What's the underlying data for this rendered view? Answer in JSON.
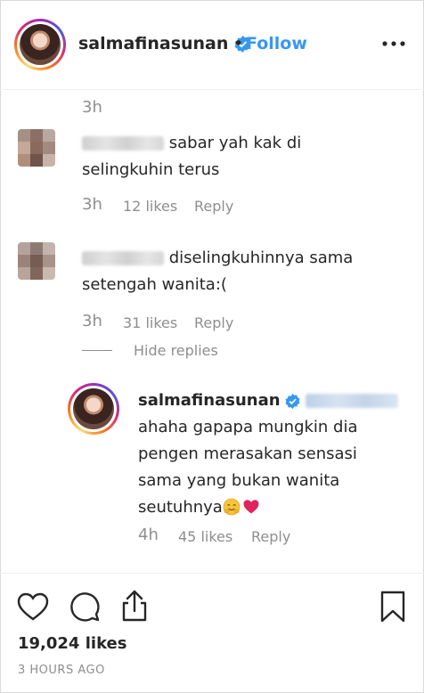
{
  "header": {
    "username": "salmafinasunan",
    "separator": "•",
    "follow_label": "Follow"
  },
  "top_time": "3h",
  "comments": [
    {
      "text_line1": "sabar yah kak di",
      "text_line2": "selingkuhin terus",
      "time": "3h",
      "likes": "12 likes",
      "reply": "Reply"
    },
    {
      "text_line1": "diselingkuhinnya sama",
      "text_line2": "setengah wanita:(",
      "time": "3h",
      "likes": "31 likes",
      "reply": "Reply",
      "hide_replies": "Hide replies"
    }
  ],
  "reply_comment": {
    "username": "salmafinasunan",
    "line1": "ahaha gapapa mungkin dia",
    "line2": "pengen merasakan sensasi",
    "line3": "sama yang bukan wanita",
    "line4": "seutuhnya",
    "time": "4h",
    "likes": "45 likes",
    "reply": "Reply"
  },
  "footer": {
    "likes": "19,024 likes",
    "posted": "3 HOURS AGO"
  },
  "colors": {
    "link": "#3897f0",
    "muted": "#8e8e8e",
    "text": "#262626",
    "heart": "#e0245e"
  }
}
